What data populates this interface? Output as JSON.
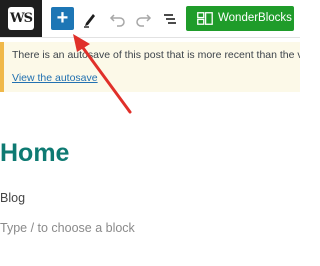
{
  "toolbar": {
    "logo_text": "WS",
    "inserter_label": "+",
    "tools": [
      "pen-icon",
      "undo-icon",
      "redo-icon",
      "list-view-icon"
    ],
    "wonderblocks_label": "WonderBlocks",
    "accent": "#1d76b5",
    "wonderblocks_color": "#1f9c2a"
  },
  "notice": {
    "message": "There is an autosave of this post that is more recent than the version below.",
    "link_label": "View the autosave",
    "border_color": "#f0b849"
  },
  "content": {
    "title": "Home",
    "paragraph": "Blog",
    "placeholder": "Type / to choose a block",
    "title_color": "#0e7a72"
  },
  "annotation": {
    "type": "arrow",
    "color": "#e0302a",
    "points_to": "inserter-button"
  }
}
